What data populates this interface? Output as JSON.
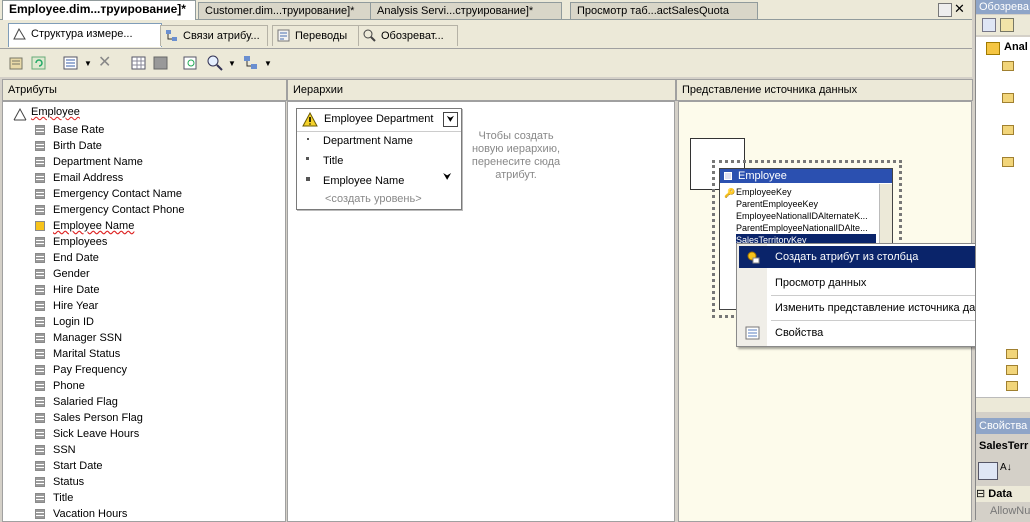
{
  "doc_tabs": [
    {
      "label": "Employee.dim...труирование]*"
    },
    {
      "label": "Customer.dim...труирование]*"
    },
    {
      "label": "Analysis Servi...струирование]*"
    },
    {
      "label": "Просмотр таб...actSalesQuota"
    }
  ],
  "sub_tabs": [
    {
      "label": "Структура измере..."
    },
    {
      "label": "Связи атрибу..."
    },
    {
      "label": "Переводы"
    },
    {
      "label": "Обозреват..."
    }
  ],
  "attributes_pane": {
    "title": "Атрибуты",
    "root": "Employee",
    "items": [
      "Base Rate",
      "Birth Date",
      "Department Name",
      "Email Address",
      "Emergency Contact Name",
      "Emergency Contact Phone",
      "Employee Name",
      "Employees",
      "End Date",
      "Gender",
      "Hire Date",
      "Hire Year",
      "Login ID",
      "Manager SSN",
      "Marital Status",
      "Pay Frequency",
      "Phone",
      "Salaried Flag",
      "Sales Person Flag",
      "Sick Leave Hours",
      "SSN",
      "Start Date",
      "Status",
      "Title",
      "Vacation Hours"
    ]
  },
  "hierarchies_pane": {
    "title": "Иерархии",
    "hierarchy_name": "Employee Department",
    "levels": [
      "Department Name",
      "Title",
      "Employee Name"
    ],
    "new_level": "<создать уровень>",
    "hint": "Чтобы создать новую иерархию, перенесите сюда атрибут."
  },
  "dsv_pane": {
    "title": "Представление источника данных",
    "table_name": "Employee",
    "columns": [
      "EmployeeKey",
      "ParentEmployeeKey",
      "EmployeeNationalIDAlternateK...",
      "ParentEmployeeNationalIDAlte...",
      "SalesTerritoryKey"
    ],
    "selected_column": "SalesTerritoryKey"
  },
  "context_menu": {
    "items": [
      {
        "label": "Создать атрибут из столбца",
        "highlighted": true
      },
      {
        "label": "Просмотр данных"
      },
      {
        "label": "Изменить представление источника данных"
      },
      {
        "label": "Свойства"
      }
    ]
  },
  "right_panel": {
    "top_title": "Обозрева",
    "tree_item": "Anal",
    "properties_title": "Свойства",
    "properties_object": "SalesTerr",
    "category": "Data",
    "property": "AllowNu"
  },
  "colors": {
    "highlight": "#0a246a",
    "dsv_bg": "#fdfbeb",
    "table_title": "#1f47a8"
  }
}
